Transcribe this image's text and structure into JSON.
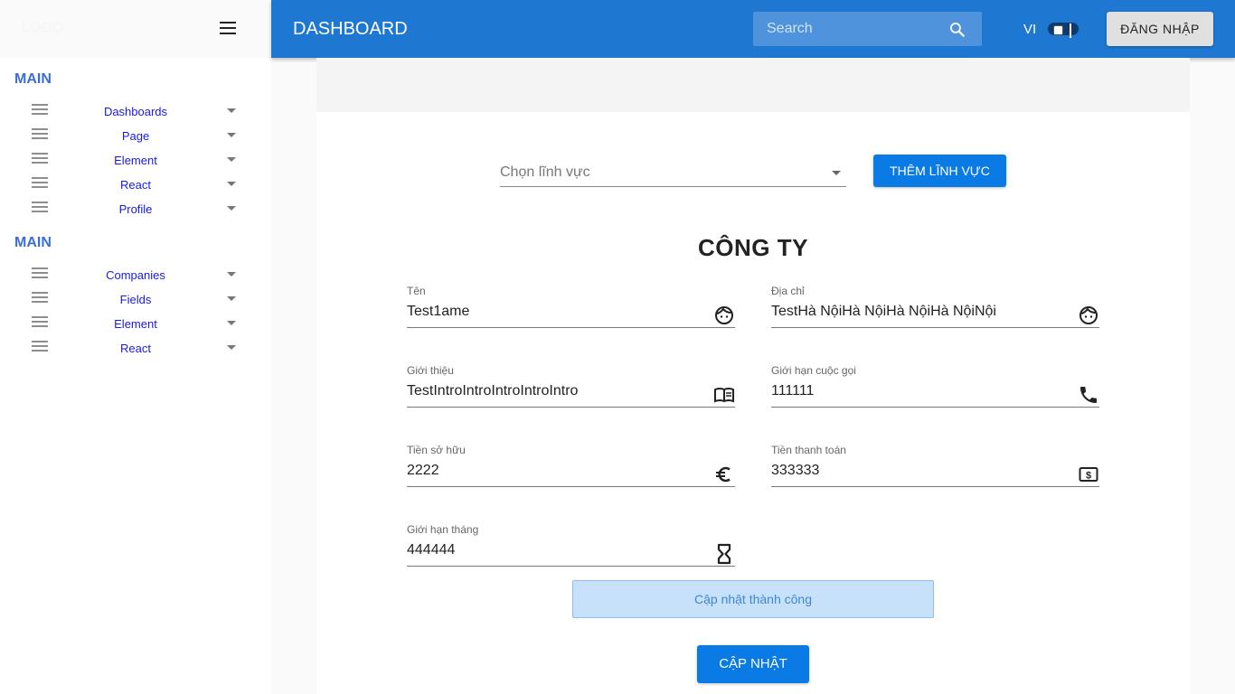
{
  "sidebar": {
    "logo": "LOGO",
    "sections": [
      {
        "title": "MAIN",
        "items": [
          {
            "label": "Dashboards"
          },
          {
            "label": "Page"
          },
          {
            "label": "Element"
          },
          {
            "label": "React"
          },
          {
            "label": "Profile"
          }
        ]
      },
      {
        "title": "MAIN",
        "items": [
          {
            "label": "Companies"
          },
          {
            "label": "Fields"
          },
          {
            "label": "Element"
          },
          {
            "label": "React"
          }
        ]
      }
    ]
  },
  "topbar": {
    "title": "DASHBOARD",
    "search_placeholder": "Search",
    "language": "VI",
    "login_label": "ĐĂNG NHẬP"
  },
  "content": {
    "select_placeholder": "Chọn lĩnh vực",
    "add_field_label": "THÊM LĨNH VỰC",
    "form_title": "CÔNG TY",
    "fields": {
      "name": {
        "label": "Tên",
        "value": "Test1ame",
        "icon": "face-icon"
      },
      "address": {
        "label": "Địa chỉ",
        "value": "TestHà NộiHà NộiHà NộiHà NộiNội",
        "icon": "face-icon"
      },
      "intro": {
        "label": "Giới thiệu",
        "value": "TestIntroIntroIntroIntroIntro",
        "icon": "menu-book-icon"
      },
      "call_limit": {
        "label": "Giới hạn cuộc gọi",
        "value": "111111",
        "icon": "phone-icon"
      },
      "owned_money": {
        "label": "Tiền sở hữu",
        "value": "2222",
        "icon": "euro-icon"
      },
      "payment": {
        "label": "Tiền thanh toán",
        "value": "333333",
        "icon": "money-icon"
      },
      "month_limit": {
        "label": "Giới hạn tháng",
        "value": "444444",
        "icon": "hourglass-icon"
      }
    },
    "toast": "Cập nhật thành công",
    "update_label": "CẬP NHẬT"
  },
  "colors": {
    "primary": "#1e78d2",
    "button": "#0a7be5",
    "section_title": "#3b6fd0",
    "nav_link": "#1a1ae0",
    "toast_bg": "#c8e1fb"
  }
}
